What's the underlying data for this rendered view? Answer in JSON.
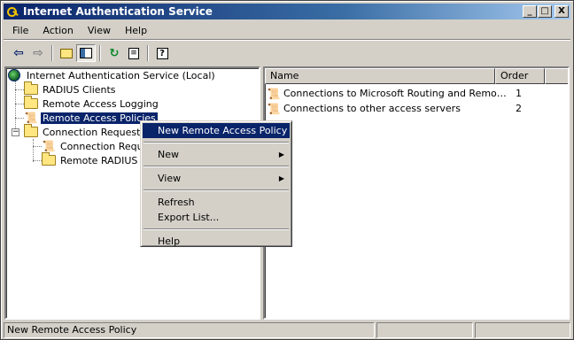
{
  "window": {
    "title": "Internet Authentication Service",
    "buttons": {
      "minimize": "_",
      "maximize": "□",
      "close": "X"
    }
  },
  "menubar": {
    "items": [
      {
        "label": "File"
      },
      {
        "label": "Action"
      },
      {
        "label": "View"
      },
      {
        "label": "Help"
      }
    ]
  },
  "toolbar": {
    "buttons": [
      "back-arrow-icon",
      "forward-arrow-icon",
      "up-folder-icon",
      "show-hide-tree-icon",
      "refresh-icon",
      "export-list-icon",
      "help-icon"
    ]
  },
  "tree": {
    "root": "Internet Authentication Service (Local)",
    "items": [
      {
        "label": "RADIUS Clients"
      },
      {
        "label": "Remote Access Logging"
      },
      {
        "label": "Remote Access Policies"
      },
      {
        "label": "Connection Request Pr"
      },
      {
        "label": "Connection Reques"
      },
      {
        "label": "Remote RADIUS Se"
      }
    ]
  },
  "list": {
    "columns": [
      "Name",
      "Order"
    ],
    "rows": [
      {
        "name": "Connections to Microsoft Routing and Remote ...",
        "order": "1"
      },
      {
        "name": "Connections to other access servers",
        "order": "2"
      }
    ]
  },
  "context_menu": {
    "items": [
      {
        "label": "New Remote Access Policy"
      },
      {
        "label": "New"
      },
      {
        "label": "View"
      },
      {
        "label": "Refresh"
      },
      {
        "label": "Export List..."
      },
      {
        "label": "Help"
      }
    ]
  },
  "status": {
    "text": "New Remote Access Policy"
  }
}
